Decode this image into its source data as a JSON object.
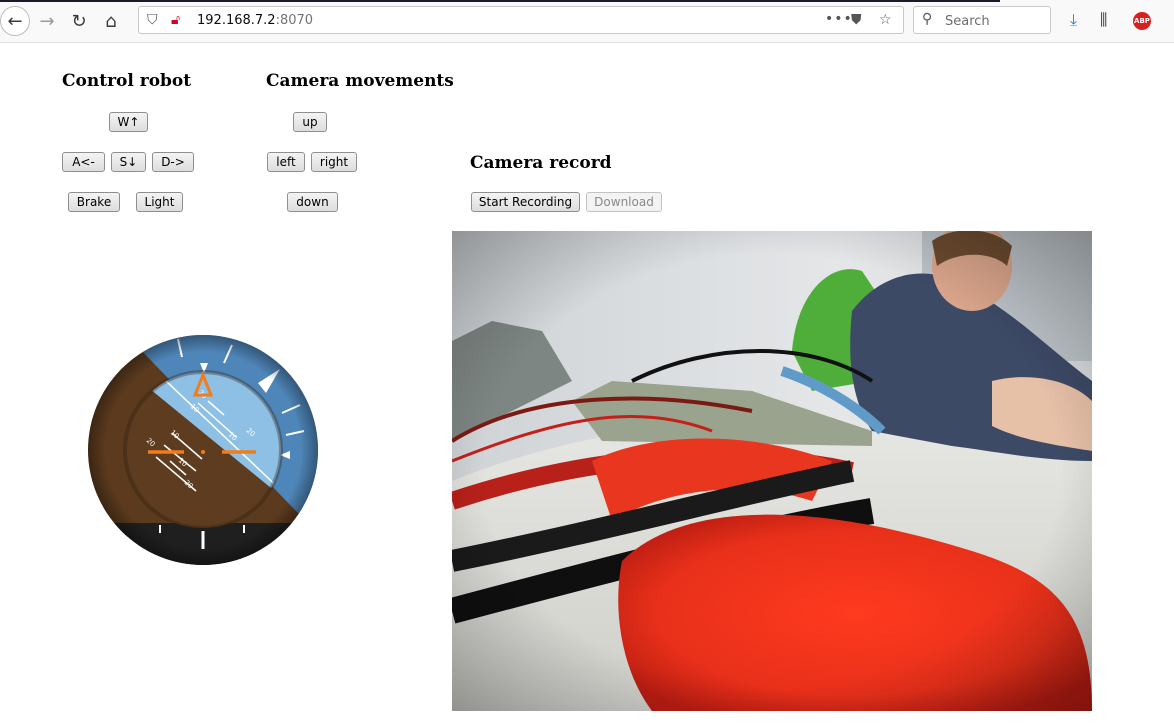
{
  "browser": {
    "url_host": "192.168.7.2",
    "url_port": ":8070",
    "search_placeholder": "Search",
    "adblock_label": "ABP"
  },
  "control": {
    "heading": "Control robot",
    "forward": "W↑",
    "left": "A<-",
    "back": "S↓",
    "right": "D->",
    "brake": "Brake",
    "light": "Light"
  },
  "camera_moves": {
    "heading": "Camera movements",
    "up": "up",
    "left": "left",
    "right": "right",
    "down": "down"
  },
  "record": {
    "heading": "Camera record",
    "start": "Start Recording",
    "download": "Download"
  },
  "attitude": {
    "scale_labels": [
      "20",
      "10",
      "10",
      "20",
      "10",
      "20",
      "20",
      "10"
    ]
  },
  "colors": {
    "sky": "#5a8ec0",
    "ground": "#5b3a1e",
    "pointer": "#f07d1a"
  }
}
